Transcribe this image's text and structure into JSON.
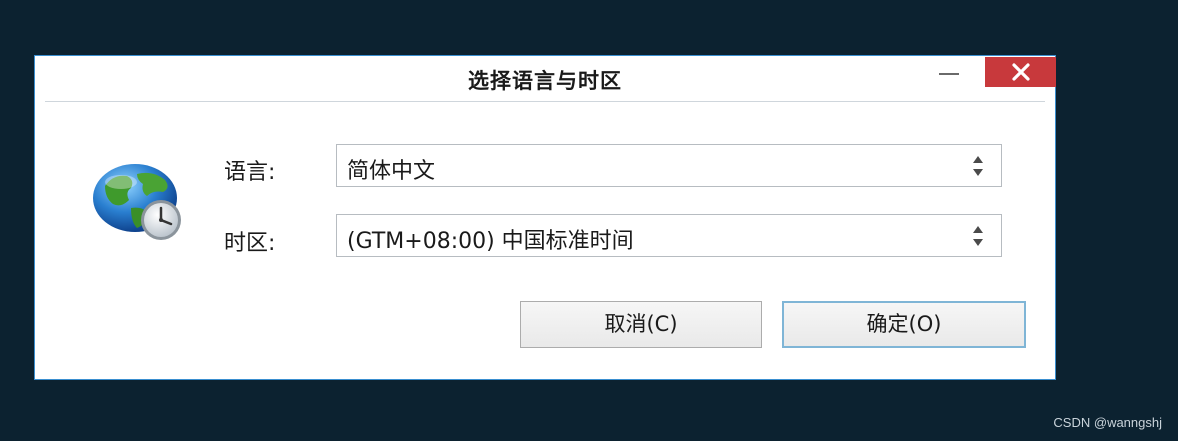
{
  "window": {
    "title": "选择语言与时区"
  },
  "form": {
    "language_label": "语言:",
    "language_value": "简体中文",
    "timezone_label": "时区:",
    "timezone_value": "(GTM+08:00) 中国标准时间"
  },
  "buttons": {
    "cancel_label": "取消(C)",
    "ok_label": "确定(O)"
  },
  "icons": {
    "app_icon": "globe-clock-icon",
    "minimize": "minimize-icon",
    "close": "close-icon",
    "spin": "up-down-arrows-icon"
  },
  "colors": {
    "background": "#0c2230",
    "close_button": "#c8393c",
    "default_button_border": "#7fb5d6"
  },
  "watermark": "CSDN @wanngshj"
}
